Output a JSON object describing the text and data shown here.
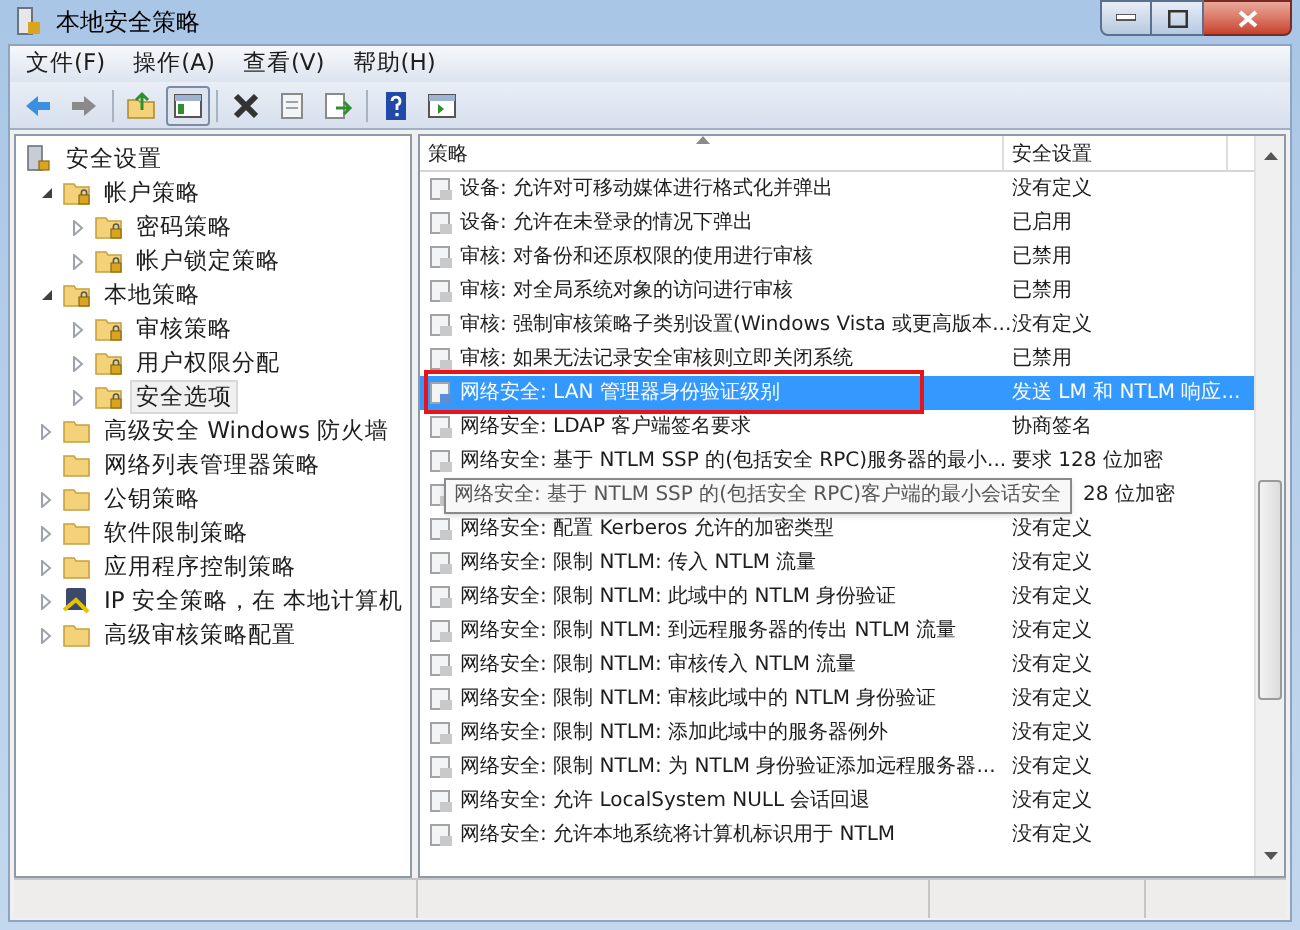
{
  "window": {
    "title": "本地安全策略"
  },
  "menu": [
    "文件(F)",
    "操作(A)",
    "查看(V)",
    "帮助(H)"
  ],
  "tree": [
    {
      "label": "安全设置",
      "kind": "root",
      "selected": false,
      "children": [
        {
          "label": "帐户策略",
          "kind": "lock_folder",
          "expanded": true,
          "selected": false,
          "children": [
            {
              "label": "密码策略",
              "kind": "lock_folder",
              "expanded": false,
              "selected": false
            },
            {
              "label": "帐户锁定策略",
              "kind": "lock_folder",
              "expanded": false,
              "selected": false
            }
          ]
        },
        {
          "label": "本地策略",
          "kind": "lock_folder",
          "expanded": true,
          "selected": false,
          "children": [
            {
              "label": "审核策略",
              "kind": "lock_folder",
              "expanded": false,
              "selected": false
            },
            {
              "label": "用户权限分配",
              "kind": "lock_folder",
              "expanded": false,
              "selected": false
            },
            {
              "label": "安全选项",
              "kind": "lock_folder",
              "expanded": false,
              "selected": true
            }
          ]
        },
        {
          "label": "高级安全 Windows 防火墙",
          "kind": "folder",
          "expanded": false,
          "selected": false
        },
        {
          "label": "网络列表管理器策略",
          "kind": "folder",
          "selected": false
        },
        {
          "label": "公钥策略",
          "kind": "folder",
          "expanded": false,
          "selected": false
        },
        {
          "label": "软件限制策略",
          "kind": "folder",
          "expanded": false,
          "selected": false
        },
        {
          "label": "应用程序控制策略",
          "kind": "folder",
          "expanded": false,
          "selected": false
        },
        {
          "label": "IP 安全策略，在 本地计算机",
          "kind": "ip_security",
          "expanded": false,
          "selected": false
        },
        {
          "label": "高级审核策略配置",
          "kind": "folder",
          "expanded": false,
          "selected": false
        }
      ]
    }
  ],
  "table": {
    "columns": [
      "策略",
      "安全设置"
    ],
    "rows": [
      {
        "policy": "设备: 允许对可移动媒体进行格式化并弹出",
        "setting": "没有定义",
        "selected": false
      },
      {
        "policy": "设备: 允许在未登录的情况下弹出",
        "setting": "已启用",
        "selected": false
      },
      {
        "policy": "审核: 对备份和还原权限的使用进行审核",
        "setting": "已禁用",
        "selected": false
      },
      {
        "policy": "审核: 对全局系统对象的访问进行审核",
        "setting": "已禁用",
        "selected": false
      },
      {
        "policy": "审核: 强制审核策略子类别设置(Windows Vista 或更高版本...",
        "setting": "没有定义",
        "selected": false
      },
      {
        "policy": "审核: 如果无法记录安全审核则立即关闭系统",
        "setting": "已禁用",
        "selected": false
      },
      {
        "policy": "网络安全: LAN 管理器身份验证级别",
        "setting": "发送 LM 和 NTLM 响应...",
        "selected": true
      },
      {
        "policy": "网络安全: LDAP 客户端签名要求",
        "setting": "协商签名",
        "selected": false
      },
      {
        "policy": "网络安全: 基于 NTLM SSP 的(包括安全 RPC)服务器的最小...",
        "setting": "要求 128 位加密",
        "selected": false
      },
      {
        "setting": "28 位加密",
        "selected": false,
        "tooltip": "网络安全: 基于 NTLM SSP 的(包括安全 RPC)客户端的最小会话安全"
      },
      {
        "policy": "网络安全: 配置 Kerberos 允许的加密类型",
        "setting": "没有定义",
        "selected": false
      },
      {
        "policy": "网络安全: 限制 NTLM: 传入 NTLM 流量",
        "setting": "没有定义",
        "selected": false
      },
      {
        "policy": "网络安全: 限制 NTLM: 此域中的 NTLM 身份验证",
        "setting": "没有定义",
        "selected": false
      },
      {
        "policy": "网络安全: 限制 NTLM: 到远程服务器的传出 NTLM 流量",
        "setting": "没有定义",
        "selected": false
      },
      {
        "policy": "网络安全: 限制 NTLM: 审核传入 NTLM 流量",
        "setting": "没有定义",
        "selected": false
      },
      {
        "policy": "网络安全: 限制 NTLM: 审核此域中的 NTLM 身份验证",
        "setting": "没有定义",
        "selected": false
      },
      {
        "policy": "网络安全: 限制 NTLM: 添加此域中的服务器例外",
        "setting": "没有定义",
        "selected": false
      },
      {
        "policy": "网络安全: 限制 NTLM: 为 NTLM 身份验证添加远程服务器...",
        "setting": "没有定义",
        "selected": false
      },
      {
        "policy": "网络安全: 允许 LocalSystem NULL 会话回退",
        "setting": "没有定义",
        "selected": false
      },
      {
        "policy": "网络安全: 允许本地系统将计算机标识用于 NTLM",
        "setting": "没有定义",
        "selected": false
      }
    ]
  }
}
